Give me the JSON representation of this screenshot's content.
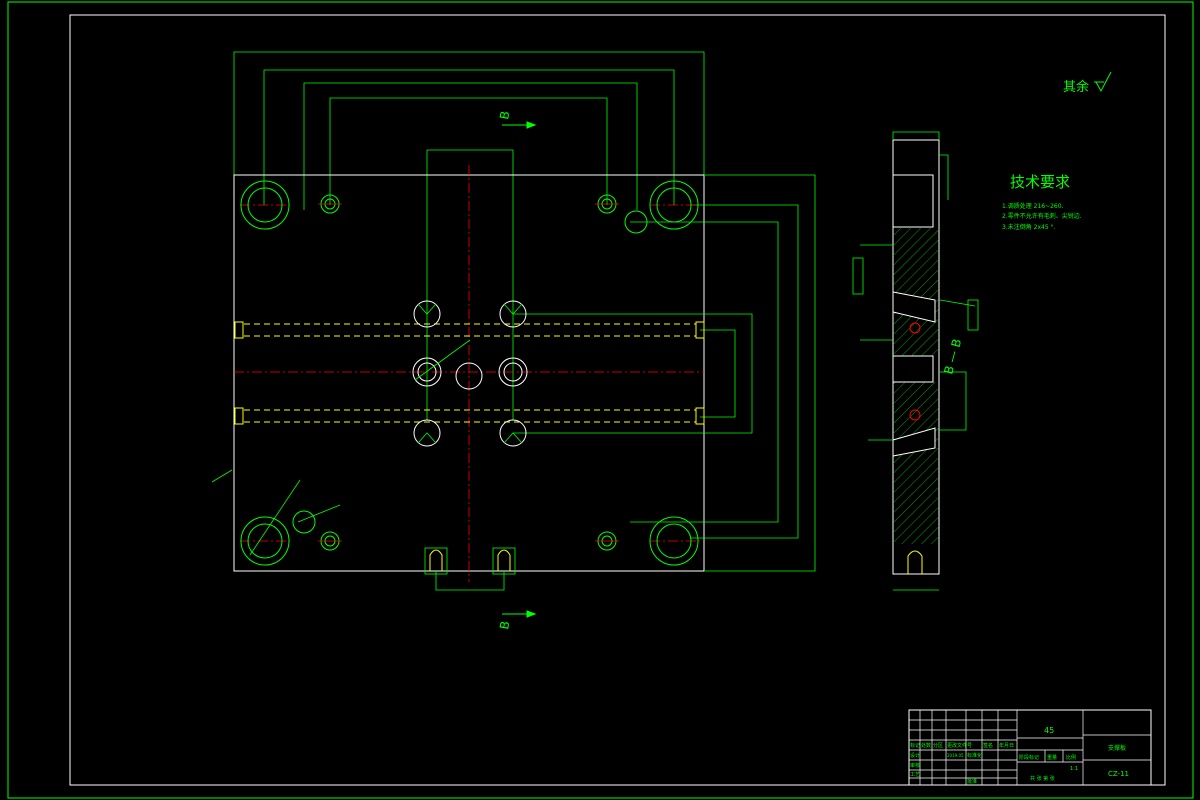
{
  "colors": {
    "background": "#000000",
    "frame": "#00ff00",
    "plate": "#ffffff",
    "dimension": "#00ff00",
    "centerline": "#ff0000",
    "hidden": "#ffff00",
    "annotation": "#00ff00",
    "hatch": "#00cc00"
  },
  "drawing": {
    "roughness_note": "其余",
    "roughness_value": "",
    "section_label_top": "B",
    "section_label_bottom": "B",
    "section_view_label": "B — B",
    "tech_requirements": {
      "title": "技术要求",
      "lines": [
        "1.调质处理 216~260.",
        "2.零件不允许有毛刺、尖锐边.",
        "3.未注倒角 2x45 °."
      ]
    }
  },
  "title_block": {
    "material": "45",
    "part_name": "支撑板",
    "drawing_number": "CZ-11",
    "scale_header": "比例",
    "scale_value": "1:1",
    "weight_header": "重量",
    "stage_header": "阶段标记",
    "sheet_text": "共 张 第 张",
    "row_labels": [
      "标记",
      "设计",
      "审核",
      "工艺"
    ],
    "header_labels": [
      "处数",
      "分区",
      "更改文件号",
      "签名",
      "年月日"
    ],
    "date_text": "2019.05",
    "standard_text": "标准化",
    "approve_text": "批准"
  }
}
